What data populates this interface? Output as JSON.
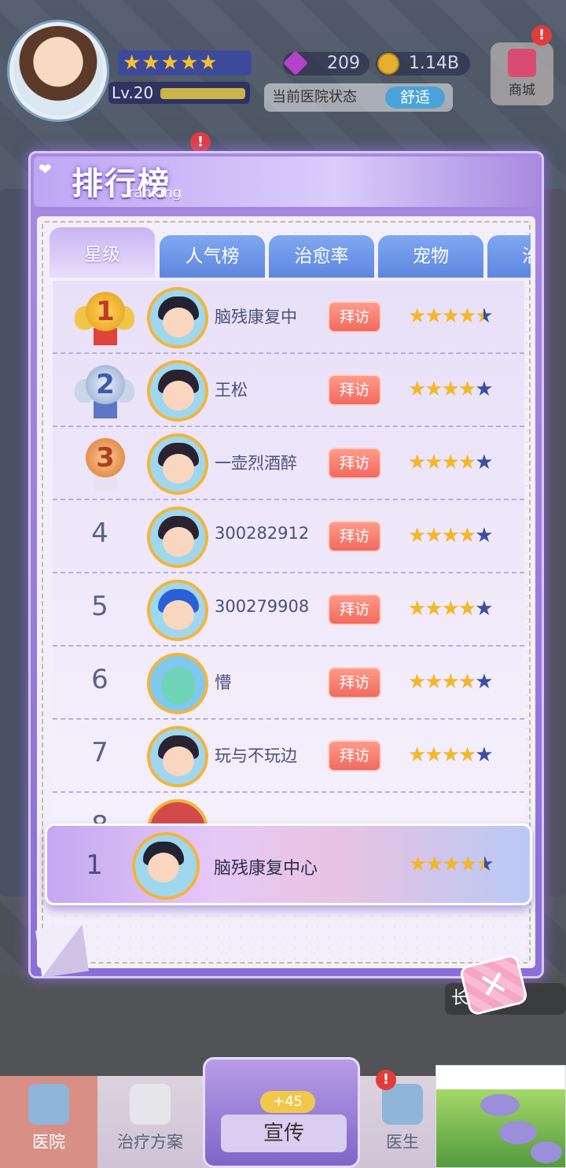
{
  "hud": {
    "level": "Lv.20",
    "gems": "209",
    "coins": "1.14B",
    "status_label": "当前医院状态",
    "status_value": "舒适",
    "shop_label": "商城",
    "player_stars": "★★★★★"
  },
  "panel": {
    "title_cn": "排行榜",
    "title_en": "ranking",
    "heart_glyph": "❤"
  },
  "tabs": [
    {
      "label": "星级",
      "active": true
    },
    {
      "label": "人气榜",
      "active": false
    },
    {
      "label": "治愈率",
      "active": false
    },
    {
      "label": "宠物",
      "active": false
    },
    {
      "label": "治疗",
      "active": false
    }
  ],
  "rows": [
    {
      "rank": "1",
      "name": "脑残康复中",
      "visit": "拜访",
      "stars_full": "★★★★",
      "stars_half": "★",
      "stars_dark": ""
    },
    {
      "rank": "2",
      "name": "王松",
      "visit": "拜访",
      "stars_full": "★★★★",
      "stars_half": "",
      "stars_dark": "★"
    },
    {
      "rank": "3",
      "name": "一壶烈酒醉",
      "visit": "拜访",
      "stars_full": "★★★★",
      "stars_half": "",
      "stars_dark": "★"
    },
    {
      "rank": "4",
      "name": "300282912",
      "visit": "拜访",
      "stars_full": "★★★★",
      "stars_half": "",
      "stars_dark": "★"
    },
    {
      "rank": "5",
      "name": "300279908",
      "visit": "拜访",
      "stars_full": "★★★★",
      "stars_half": "",
      "stars_dark": "★"
    },
    {
      "rank": "6",
      "name": "懵",
      "visit": "拜访",
      "stars_full": "★★★★",
      "stars_half": "",
      "stars_dark": "★"
    },
    {
      "rank": "7",
      "name": "玩与不玩边",
      "visit": "拜访",
      "stars_full": "★★★★",
      "stars_half": "",
      "stars_dark": "★"
    },
    {
      "rank": "8",
      "name": "",
      "visit": "",
      "stars_full": "",
      "stars_half": "",
      "stars_dark": ""
    }
  ],
  "my_rank": {
    "rank": "1",
    "name": "脑残康复中心",
    "stars_full": "★★★★",
    "stars_half": "★"
  },
  "close_glyph": "✕",
  "speed_label": "长按加速",
  "bottom_nav": {
    "hospital": "医院",
    "treatment": "治疗方案",
    "promo": "宣传",
    "promo_bonus": "+45",
    "doctor": "医生"
  },
  "colors": {
    "panel": "#8a70d6",
    "tab_active": "#e7defa",
    "tab_inactive": "#5f86e0",
    "visit_button": "#f06b5f",
    "star": "#f3b728",
    "star_empty": "#3c4f9e"
  }
}
